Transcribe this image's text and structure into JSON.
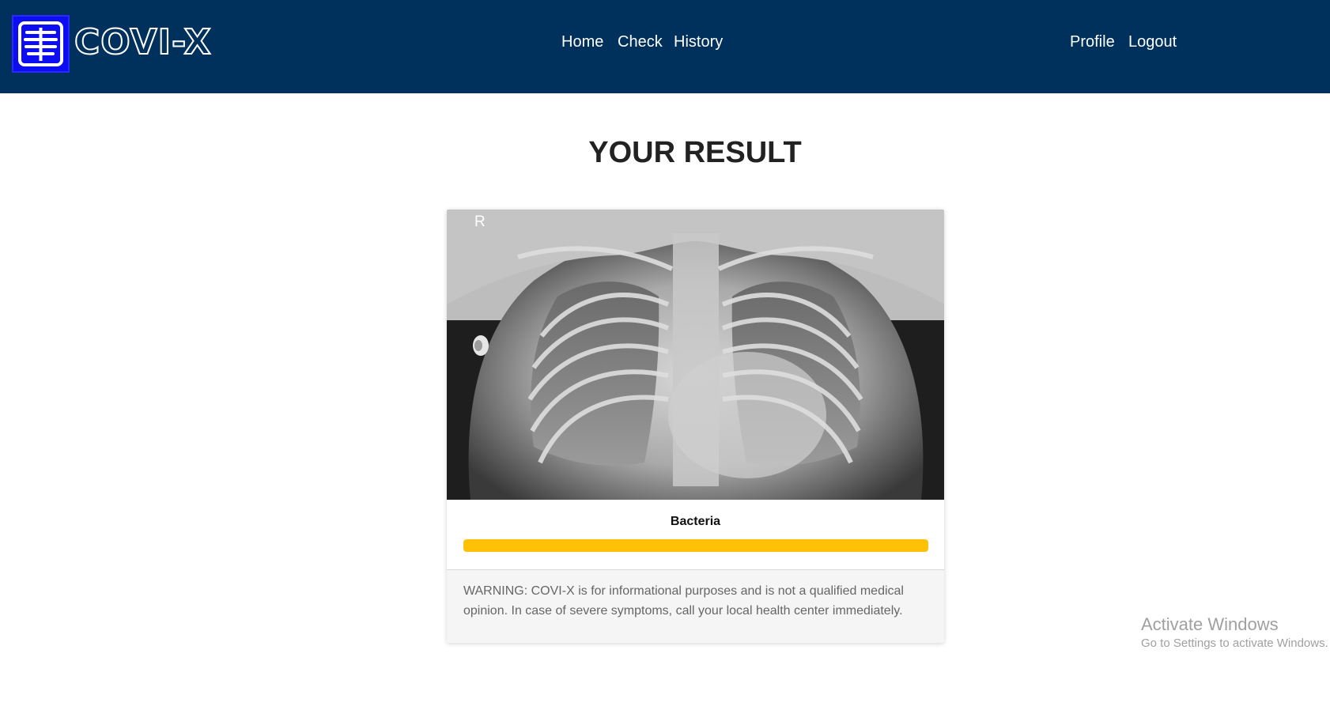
{
  "brand": {
    "name": "COVI-X",
    "logo_icon": "xray-ribcage-icon",
    "logo_color": "#0d0df2"
  },
  "navbar": {
    "background": "#00305c",
    "links": [
      "Home",
      "Check",
      "History"
    ],
    "right_links": [
      "Profile",
      "Logout"
    ]
  },
  "main": {
    "title": "YOUR RESULT",
    "result": {
      "image": "chest-xray",
      "xray_marker": "R",
      "label": "Bacteria",
      "confidence": 1.0,
      "bar_color": "#ffc107"
    },
    "warning": "WARNING: COVI-X is for informational purposes and is not a qualified medical opinion. In case of severe symptoms, call your local health center immediately."
  },
  "os_watermark": {
    "title": "Activate Windows",
    "subtitle": "Go to Settings to activate Windows."
  }
}
